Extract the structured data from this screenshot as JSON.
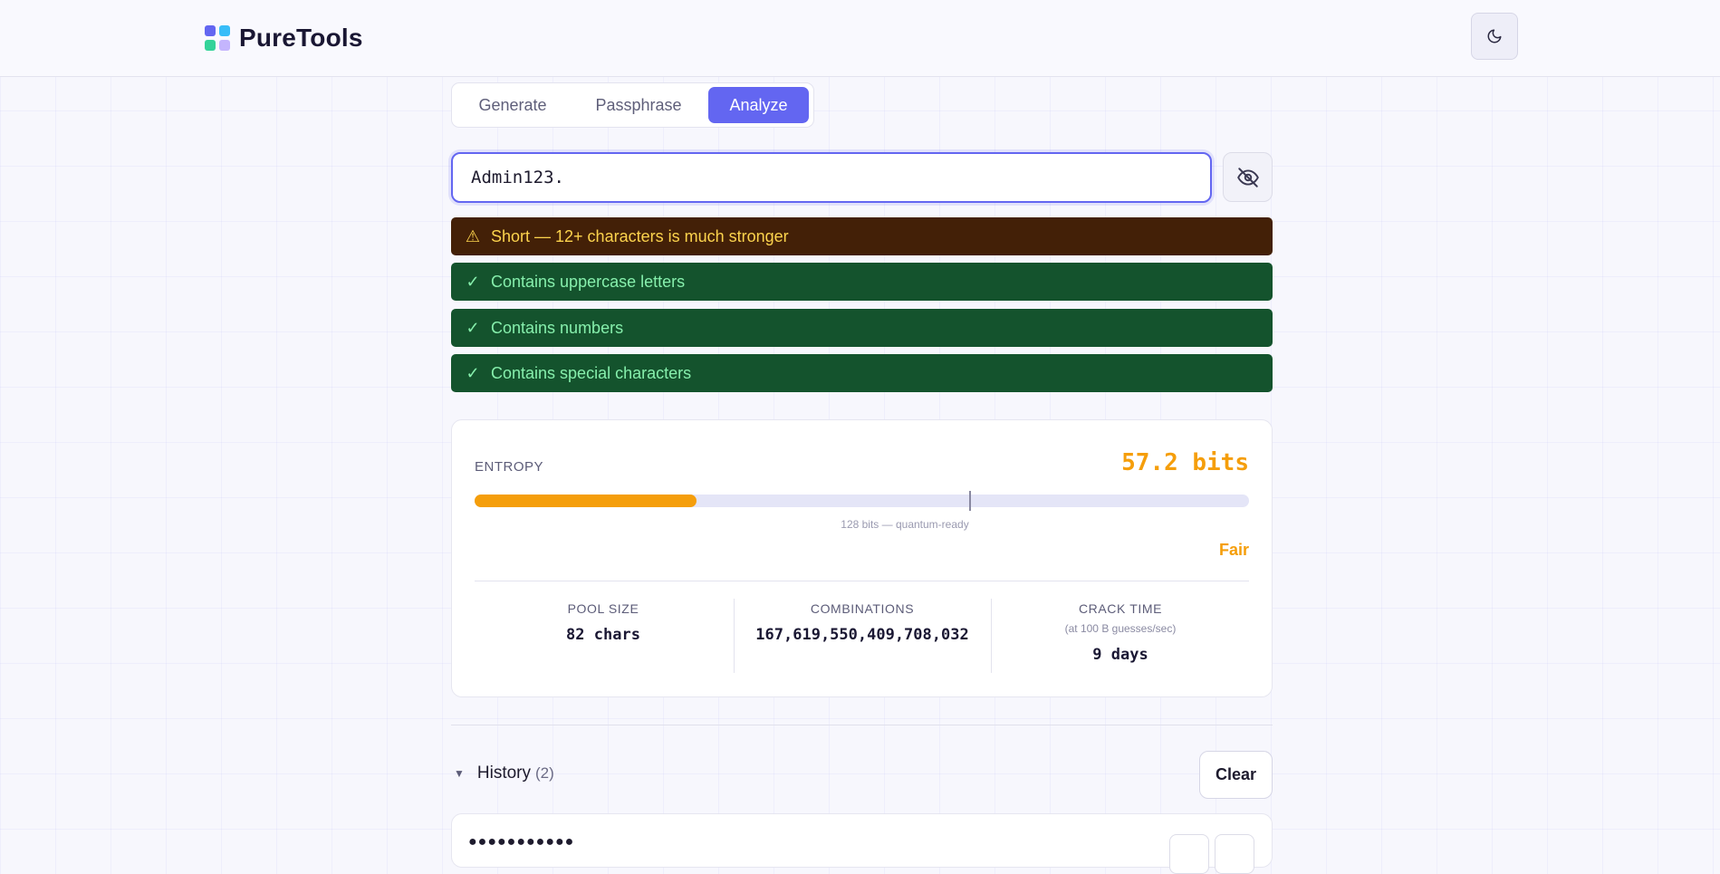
{
  "app": {
    "name": "PureTools"
  },
  "header": {
    "logo_colors": [
      "#6366f1",
      "#22d3ee",
      "#34d399",
      "#c4b5fd"
    ],
    "theme_toggle_icon": "moon-icon"
  },
  "tabs": [
    {
      "label": "Generate",
      "active": false
    },
    {
      "label": "Passphrase",
      "active": false
    },
    {
      "label": "Analyze",
      "active": true
    }
  ],
  "analyzer": {
    "password_value": "Admin123.",
    "visibility_icon": "eye-off-icon",
    "checks": [
      {
        "status": "warning",
        "icon": "⚠",
        "text": "Short — 12+ characters is much stronger"
      },
      {
        "status": "pass",
        "icon": "✓",
        "text": "Contains uppercase letters"
      },
      {
        "status": "pass",
        "icon": "✓",
        "text": "Contains numbers"
      },
      {
        "status": "pass",
        "icon": "✓",
        "text": "Contains special characters"
      }
    ]
  },
  "entropy": {
    "label": "ENTROPY",
    "value": "57.2 bits",
    "bar_fill_fraction": 0.286,
    "target_label": "128 bits — quantum-ready",
    "rating": "Fair",
    "accent_color": "#f59e0b"
  },
  "stats": [
    {
      "label": "POOL SIZE",
      "sub": "",
      "value": "82 chars"
    },
    {
      "label": "COMBINATIONS",
      "sub": "",
      "value": "167,619,550,409,708,032"
    },
    {
      "label": "CRACK TIME",
      "sub": "(at 100 B guesses/sec)",
      "value": "9 days"
    }
  ],
  "history": {
    "title": "History",
    "count": "(2)",
    "clear_label": "Clear",
    "items": [
      {
        "masked": "●●●●●●●●●●●"
      }
    ]
  }
}
